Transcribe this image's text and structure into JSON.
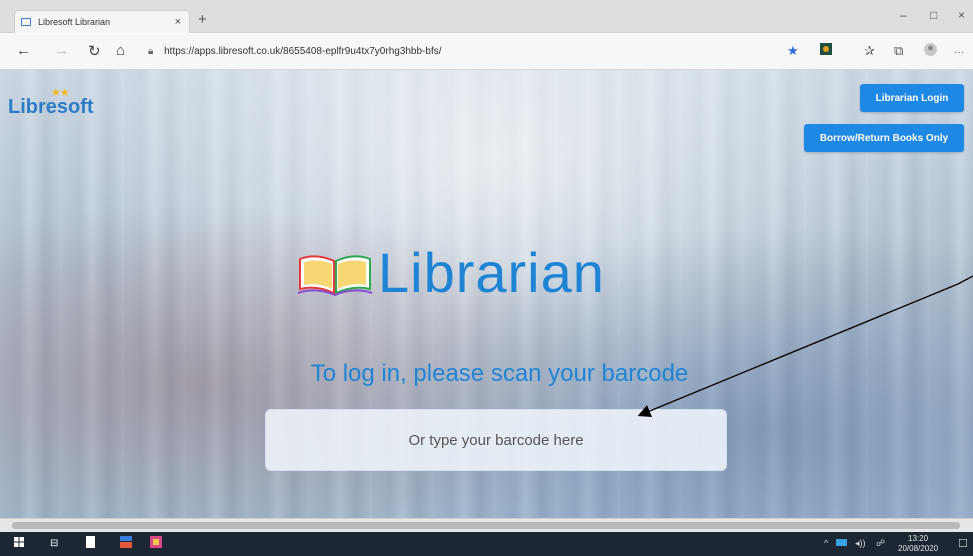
{
  "browser": {
    "tab_title": "Libresoft Librarian",
    "tab_close": "×",
    "new_tab": "+",
    "url": "https://apps.libresoft.co.uk/8655408-eplfr9u4tx7y0rhg3hbb-bfs/",
    "win_min": "–",
    "win_max": "□",
    "win_close": "×",
    "nav_back": "←",
    "nav_forward": "→",
    "nav_refresh": "↻",
    "nav_home": "⌂",
    "lock": "🔒︎",
    "more": "···"
  },
  "header": {
    "logo_text": "Libresoft",
    "logo_stars": "★★",
    "librarian_login": "Librarian Login",
    "borrow_return": "Borrow/Return Books Only"
  },
  "main": {
    "title": "Librarian",
    "subtitle": "To log in, please scan your barcode",
    "barcode_placeholder": "Or type your barcode here"
  },
  "taskbar": {
    "time": "13:20",
    "date": "20/08/2020"
  },
  "colors": {
    "accent": "#1f84d4",
    "button": "#1e88e5",
    "star": "#f3b71e",
    "taskbar": "#1c2733"
  }
}
